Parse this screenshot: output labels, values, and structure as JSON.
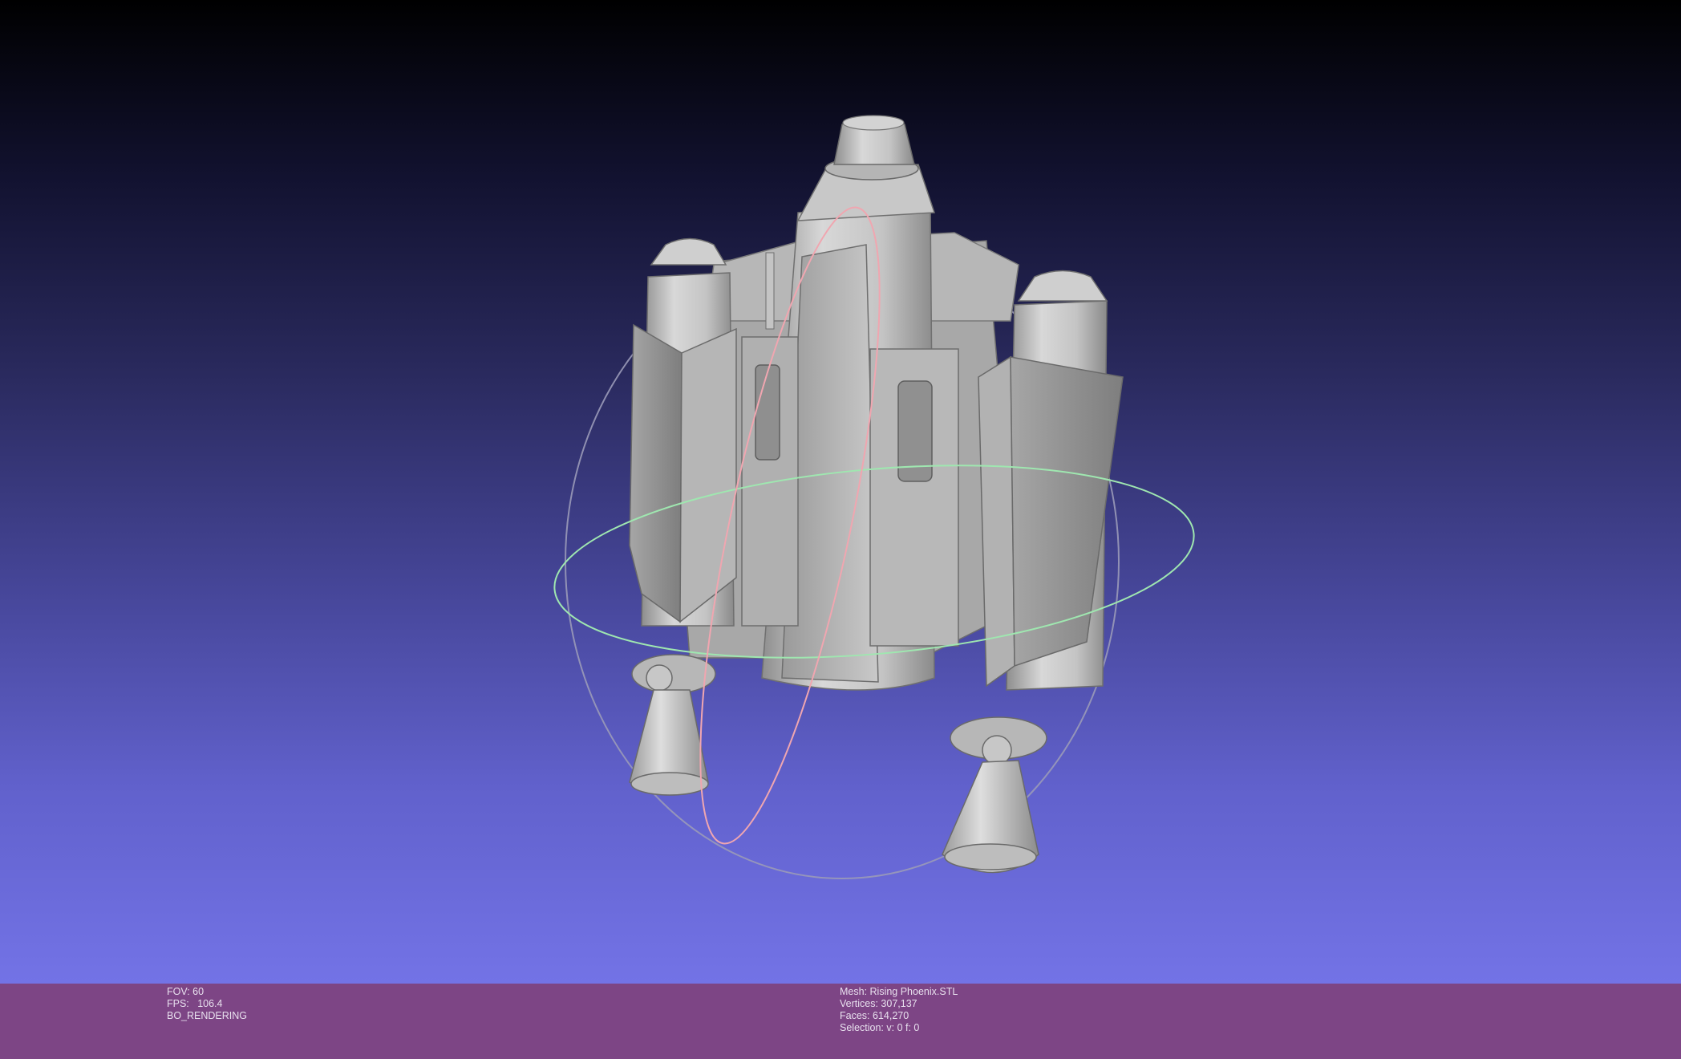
{
  "viewer": {
    "background_top": "#000000",
    "background_bottom": "#7373e6",
    "status_bar_color": "#7d4585",
    "trackball_colors": {
      "horizontal": "#9fe7b0",
      "vertical": "#f0a6b0",
      "outer": "#9a9ab8"
    },
    "mesh_color": "#bdbdbd"
  },
  "status_left": {
    "fov": "FOV: 60",
    "fps": "FPS:   106.4",
    "mode": "BO_RENDERING"
  },
  "status_right": {
    "mesh": "Mesh: Rising Phoenix.STL",
    "vertices": "Vertices: 307,137",
    "faces": "Faces: 614,270",
    "selection": "Selection: v: 0 f: 0"
  }
}
